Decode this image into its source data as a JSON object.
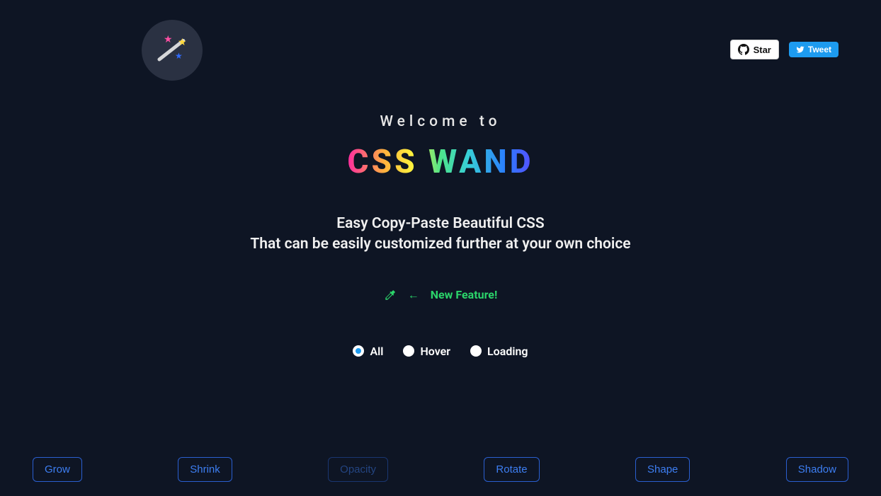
{
  "header": {
    "star_label": "Star",
    "tweet_label": "Tweet"
  },
  "hero": {
    "welcome": "Welcome to",
    "brand": "CSS WAND",
    "tagline_line1": "Easy Copy-Paste Beautiful CSS",
    "tagline_line2": "That can be easily customized further at your own choice",
    "new_feature_label": "New Feature!"
  },
  "filters": {
    "options": [
      {
        "label": "All",
        "selected": true
      },
      {
        "label": "Hover",
        "selected": false
      },
      {
        "label": "Loading",
        "selected": false
      }
    ]
  },
  "effects": [
    {
      "label": "Grow",
      "faded": false
    },
    {
      "label": "Shrink",
      "faded": false
    },
    {
      "label": "Opacity",
      "faded": true
    },
    {
      "label": "Rotate",
      "faded": false
    },
    {
      "label": "Shape",
      "faded": false
    },
    {
      "label": "Shadow",
      "faded": false
    }
  ],
  "colors": {
    "background": "#0e1524",
    "accent_green": "#2bd46a",
    "accent_blue": "#1d9bf0",
    "button_border": "#2a5fd0",
    "button_text": "#3d7ef2"
  }
}
